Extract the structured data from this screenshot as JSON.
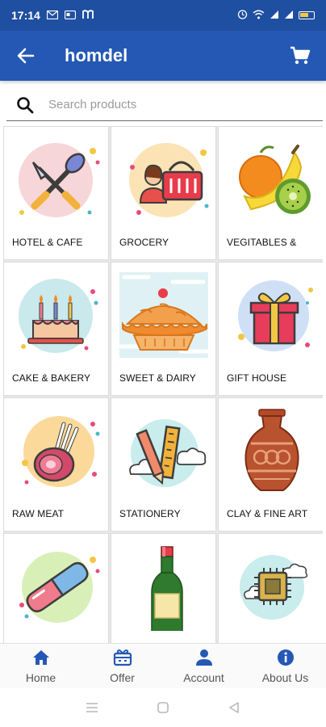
{
  "status_bar": {
    "time": "17:14",
    "left_icons": [
      "mail-icon",
      "card-icon",
      "m-logo-icon"
    ],
    "right_icons": [
      "alarm-icon",
      "wifi-icon",
      "signal-icon",
      "signal-icon",
      "battery-icon"
    ]
  },
  "app_bar": {
    "title": "homdel",
    "back_icon": "arrow-left-icon",
    "cart_icon": "cart-icon",
    "background": "#2458b4"
  },
  "search": {
    "placeholder": "Search products",
    "value": ""
  },
  "categories": [
    {
      "label": "HOTEL & CAFE",
      "icon": "utensils-icon"
    },
    {
      "label": "GROCERY",
      "icon": "basket-icon"
    },
    {
      "label": "VEGITABLES &",
      "icon": "fruits-icon"
    },
    {
      "label": "CAKE & BAKERY",
      "icon": "cake-icon"
    },
    {
      "label": "SWEET & DAIRY",
      "icon": "pie-icon"
    },
    {
      "label": "GIFT HOUSE",
      "icon": "gift-icon"
    },
    {
      "label": "RAW MEAT",
      "icon": "meat-icon"
    },
    {
      "label": "STATIONERY",
      "icon": "stationery-icon"
    },
    {
      "label": "CLAY & FINE ART",
      "icon": "vase-icon"
    },
    {
      "label": "",
      "icon": "capsule-icon"
    },
    {
      "label": "",
      "icon": "bottle-icon"
    },
    {
      "label": "",
      "icon": "chip-icon"
    }
  ],
  "bottom_nav": [
    {
      "label": "Home",
      "icon": "home-icon"
    },
    {
      "label": "Offer",
      "icon": "offer-icon"
    },
    {
      "label": "Account",
      "icon": "account-icon"
    },
    {
      "label": "About Us",
      "icon": "info-icon"
    }
  ],
  "colors": {
    "primary": "#2458b4",
    "status_bar": "#1f4fa0",
    "nav_icon": "#2458b4"
  }
}
